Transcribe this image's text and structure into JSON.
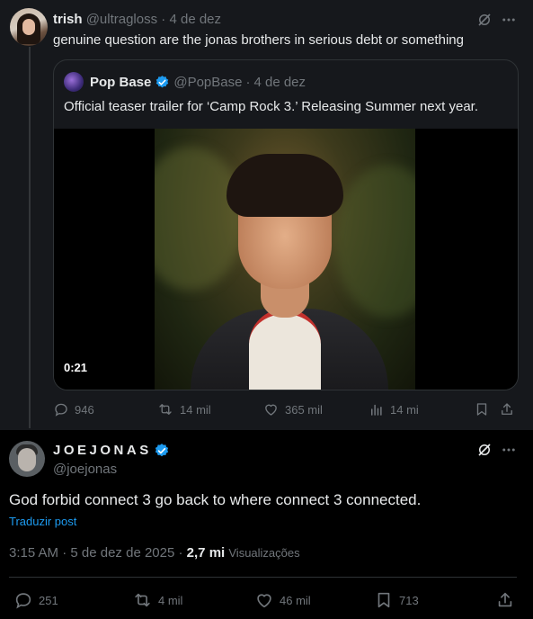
{
  "tweet1": {
    "name": "trish",
    "handle": "@ultragloss",
    "sep": "·",
    "date": "4 de dez",
    "text": "genuine question are the jonas brothers in serious debt or something",
    "quote": {
      "name": "Pop Base",
      "handle": "@PopBase",
      "sep": "·",
      "date": "4 de dez",
      "text": "Official teaser trailer for ‘Camp Rock 3.’ Releasing Summer next year.",
      "video_duration": "0:21"
    },
    "actions": {
      "replies": "946",
      "reposts": "14 mil",
      "likes": "365 mil",
      "views": "14 mi"
    }
  },
  "tweet2": {
    "name": "JOEJONAS",
    "handle": "@joejonas",
    "text": "God forbid connect 3 go back to where connect 3 connected.",
    "translate": "Traduzir post",
    "time": "3:15 AM",
    "sep": "·",
    "date": "5 de dez de 2025",
    "sep2": "·",
    "views_count": "2,7 mi",
    "views_label": "Visualizações",
    "actions": {
      "replies": "251",
      "reposts": "4 mil",
      "likes": "46 mil",
      "bookmarks": "713"
    }
  },
  "colors": {
    "accent": "#1d9bf0",
    "muted": "#71767b",
    "text": "#e7e9ea",
    "border": "#2f3336"
  }
}
